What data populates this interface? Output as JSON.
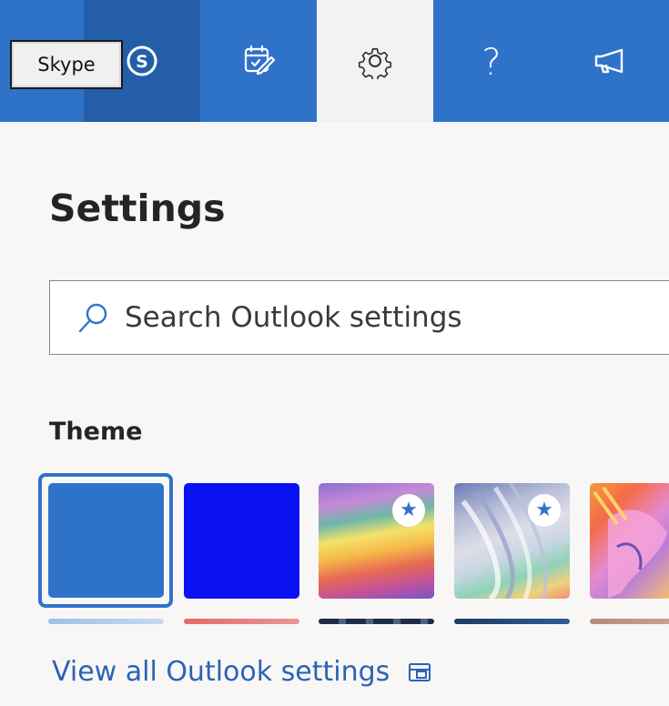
{
  "topbar": {
    "tooltip_label": "Skype",
    "buttons": [
      {
        "name": "skype-icon"
      },
      {
        "name": "calendar-check-icon"
      },
      {
        "name": "gear-icon"
      },
      {
        "name": "help-icon"
      },
      {
        "name": "megaphone-icon"
      }
    ],
    "help_glyph": "?"
  },
  "panel": {
    "title": "Settings",
    "search": {
      "placeholder": "Search Outlook settings",
      "value": ""
    },
    "theme_label": "Theme",
    "themes": [
      {
        "name": "blue",
        "color": "#2f73c9",
        "selected": true,
        "premium": false
      },
      {
        "name": "dark-blue",
        "color": "#0b12f1",
        "selected": false,
        "premium": false
      },
      {
        "name": "rainbow",
        "selected": false,
        "premium": true
      },
      {
        "name": "swirl",
        "selected": false,
        "premium": true
      },
      {
        "name": "unicorn",
        "selected": false,
        "premium": false
      }
    ],
    "star_glyph": "★",
    "view_all_link": "View all Outlook settings"
  },
  "colors": {
    "accent": "#2f73c9",
    "topbar_dark": "#245ea8",
    "link": "#2b63b5",
    "background": "#f8f7f6"
  }
}
